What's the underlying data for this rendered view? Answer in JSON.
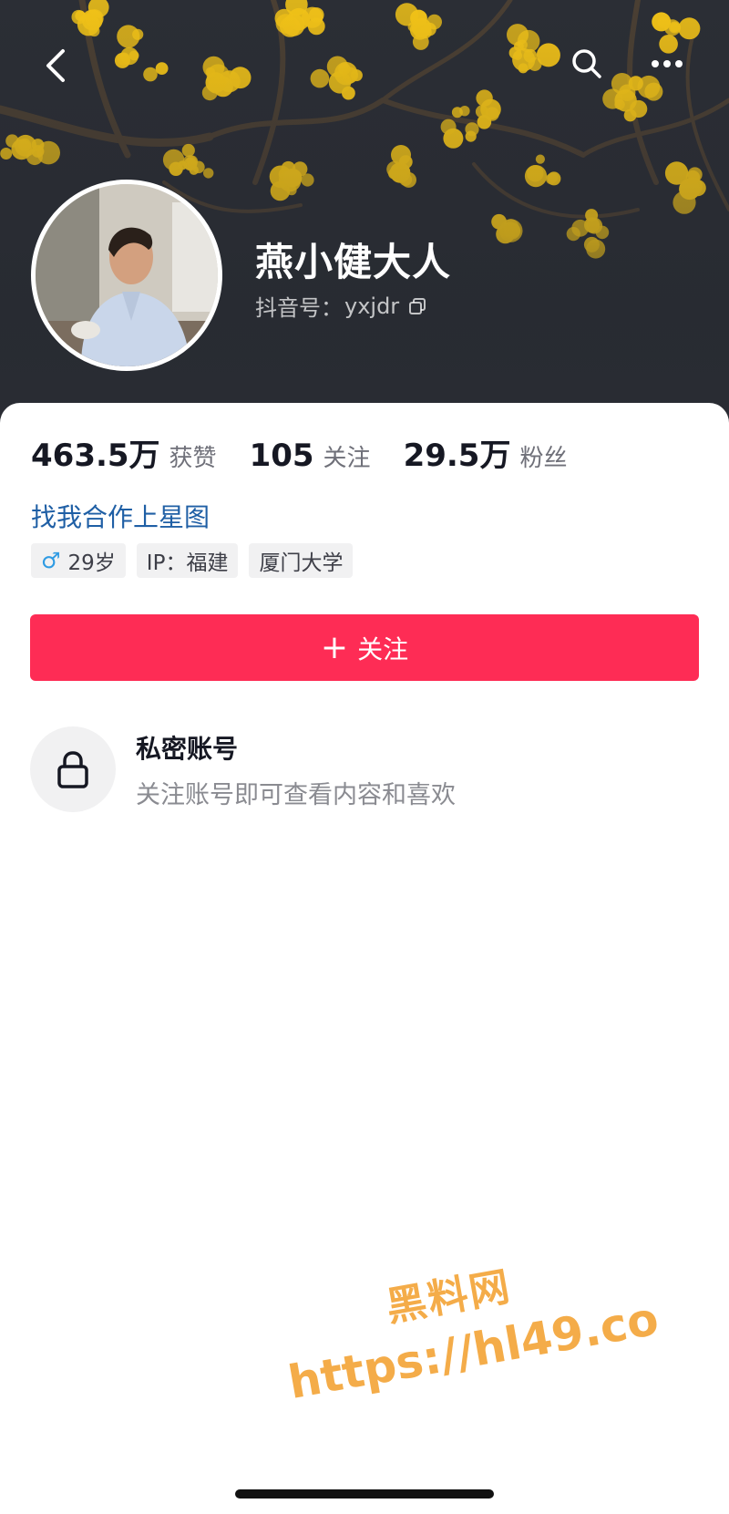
{
  "header": {
    "nickname": "燕小健大人",
    "douyin_id_label": "抖音号：",
    "douyin_id": "yxjdr",
    "icons": [
      "back-icon",
      "search-icon",
      "more-icon",
      "copy-icon"
    ]
  },
  "stats": [
    {
      "value": "463.5万",
      "label": "获赞"
    },
    {
      "value": "105",
      "label": "关注"
    },
    {
      "value": "29.5万",
      "label": "粉丝"
    }
  ],
  "cooperate_link": "找我合作上星图",
  "tags": {
    "gender_symbol": "♂",
    "age": "29岁",
    "ip": "IP：福建",
    "school": "厦门大学"
  },
  "follow_button": {
    "plus": "+",
    "label": "关注"
  },
  "private_account": {
    "title": "私密账号",
    "description": "关注账号即可查看内容和喜欢"
  },
  "watermark": {
    "title": "黑料网",
    "url": "https://hl49.co"
  },
  "colors": {
    "follow_button": "#fe2c55",
    "link": "#1f5fa5",
    "gender": "#2f9be3",
    "watermark": "#f4a63a",
    "cover_background": "#2b2e35",
    "flowers": "#f2c318"
  }
}
